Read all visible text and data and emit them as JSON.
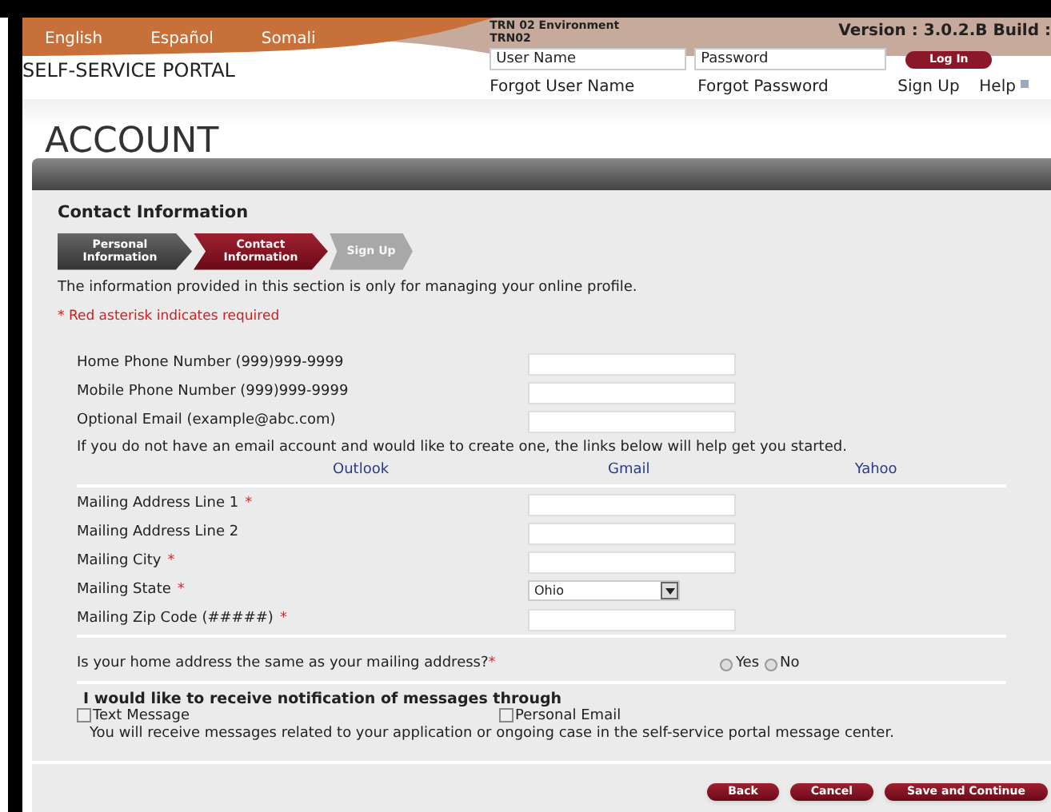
{
  "header": {
    "languages": [
      "English",
      "Español",
      "Somali"
    ],
    "environment": [
      "TRN 02 Environment",
      "TRN02"
    ],
    "version": "Version : 3.0.2.B Build :",
    "portal_title": "SELF-SERVICE PORTAL",
    "login": {
      "username_placeholder": "User Name",
      "password_placeholder": "Password",
      "button": "Log In"
    },
    "links": [
      "Forgot User Name",
      "Forgot Password",
      "Sign Up",
      "Help"
    ]
  },
  "page_title": "ACCOUNT",
  "section_title": "Contact Information",
  "steps": [
    {
      "label": "Personal Information",
      "completed": true,
      "selected": false
    },
    {
      "label": "Contact Information",
      "completed": false,
      "selected": true
    },
    {
      "label": "Sign Up",
      "completed": false,
      "selected": false
    }
  ],
  "intro": "The information provided in this section is only for managing your online profile.",
  "required_note": "* Red asterisk indicates required",
  "contact_fields": [
    {
      "label": "Home Phone Number (999)999-9999",
      "kind": "text"
    },
    {
      "label": "Mobile Phone Number (999)999-9999",
      "kind": "text"
    },
    {
      "label": "Optional Email (example@abc.com)",
      "kind": "text"
    }
  ],
  "email_help": "If you do not have an email account and would like to create one, the links below will help get you started.",
  "email_links": [
    "Outlook",
    "Gmail",
    "Yahoo"
  ],
  "address_fields": [
    {
      "label": "Mailing Address Line 1",
      "required_mark": "*",
      "kind": "text"
    },
    {
      "label": "Mailing Address Line 2",
      "kind": "text"
    },
    {
      "label": "Mailing City",
      "required_mark": "*",
      "kind": "text"
    },
    {
      "label": "Mailing State",
      "required_mark": "*",
      "kind": "select",
      "value": "Ohio"
    },
    {
      "label": "Mailing Zip Code (#####)",
      "required_mark": "*",
      "kind": "text"
    }
  ],
  "question": {
    "text": "Is your home address the same as your mailing address?",
    "required_mark": "*",
    "options": [
      {
        "label": "Yes",
        "selected": false
      },
      {
        "label": "No",
        "selected": false
      }
    ]
  },
  "notifications": {
    "title": "I would like to receive notification of messages through",
    "options": [
      {
        "label": "Text Message",
        "checked": false
      },
      {
        "label": "Personal Email",
        "checked": false
      }
    ],
    "note": "You will receive messages related to your application or ongoing case in the self-service portal message center."
  },
  "buttons": [
    "Back",
    "Cancel",
    "Save and Continue"
  ]
}
